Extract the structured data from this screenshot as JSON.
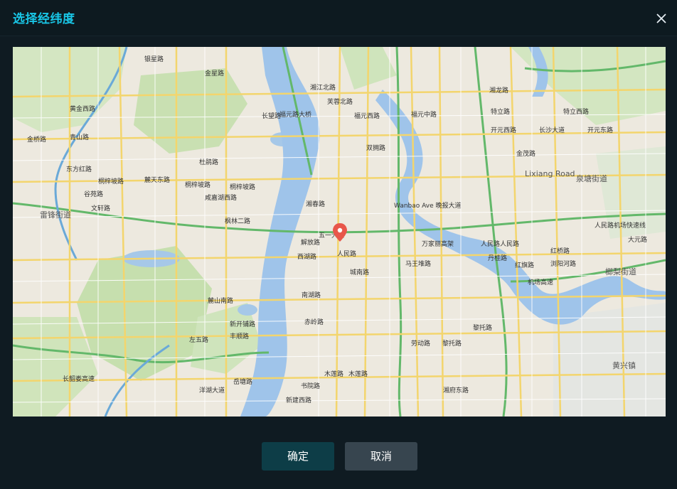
{
  "dialog": {
    "title": "选择经纬度",
    "confirm_label": "确定",
    "cancel_label": "取消"
  },
  "map": {
    "labels": {
      "l1": "银星路",
      "l2": "金星路",
      "l3": "黄金西路",
      "l4": "金桥路",
      "l5": "青山路",
      "l6": "东方红路",
      "l7": "桐梓坡路",
      "l8": "麓天东路",
      "l9": "谷苑路",
      "l10": "文轩路",
      "l11": "雷锋街道",
      "l12": "杜鹃路",
      "l13": "桐梓坡路",
      "l14": "桐梓坡路",
      "l15": "咸嘉湖西路",
      "l16": "枫林二路",
      "l17": "长望路",
      "l18": "福元路大桥",
      "l19": "福元西路",
      "l20": "福元中路",
      "l21": "双拥路",
      "l22": "湘江北路",
      "l23": "芙蓉北路",
      "l24": "湘春路",
      "l25": "五一大道",
      "l26": "解放路",
      "l27": "西湖路",
      "l28": "人民路",
      "l29": "城南路",
      "l30": "南湖路",
      "l31": "麓山南路",
      "l32": "新开铺路",
      "l33": "丰顺路",
      "l34": "左五路",
      "l35": "长韶娄高速",
      "l36": "洋湖大道",
      "l37": "岳塘路",
      "l38": "木莲路",
      "l39": "木莲路",
      "l40": "湘府东路",
      "l41": "特立路",
      "l42": "特立西路",
      "l43": "开元西路",
      "l44": "开元东路",
      "l45": "金茂路",
      "l46": "Lixiang Road",
      "l47": "泉塘街道",
      "l48": "Wanbao Ave 晚报大道",
      "l49": "万家丽高架",
      "l50": "人民路人民路",
      "l51": "人民路机场快速线",
      "l52": "大元路",
      "l53": "黎托路",
      "l54": "机场高速",
      "l55": "黄兴镇",
      "l56": "浏阳河路",
      "l57": "丹桂路",
      "l58": "马王堆路",
      "l59": "湘龙路",
      "l60": "黎托路",
      "l61": "劳动路",
      "l62": "红旗路",
      "l63": "红桥路",
      "l64": "榔梨街道",
      "l65": "长沙大道",
      "l66": "赤岭路",
      "l67": "书院路",
      "l68": "新建西路"
    }
  }
}
